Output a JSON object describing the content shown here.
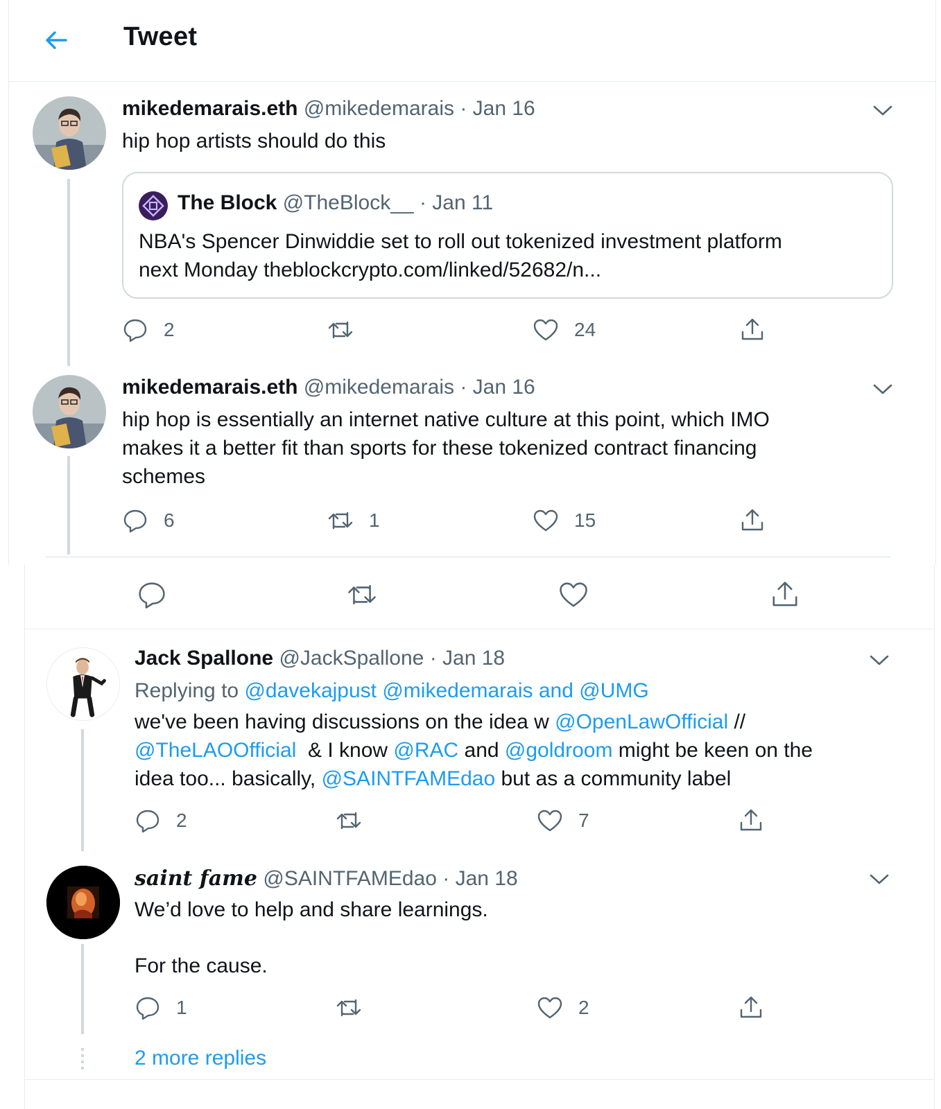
{
  "header": {
    "title": "Tweet"
  },
  "tweet1": {
    "name": "mikedemarais.eth",
    "handle": "@mikedemarais",
    "date": "· Jan 16",
    "text": "hip hop artists should do this",
    "quote": {
      "name": "The Block",
      "handle": "@TheBlock__",
      "date": "· Jan 11",
      "text_line1": "NBA's Spencer Dinwiddie set to roll out tokenized investment platform",
      "text_line2": "next Monday theblockcrypto.com/linked/52682/n..."
    },
    "replies": "2",
    "retweets": "",
    "likes": "24"
  },
  "tweet2": {
    "name": "mikedemarais.eth",
    "handle": "@mikedemarais",
    "date": "· Jan 16",
    "text_line1": "hip hop is essentially an internet native culture at this point, which IMO",
    "text_line2": "makes it a better fit than sports for these tokenized contract financing",
    "text_line3": "schemes",
    "replies": "6",
    "retweets": "1",
    "likes": "15"
  },
  "tweet3": {
    "name": "Jack Spallone",
    "handle": "@JackSpallone",
    "date": "· Jan 18",
    "replying_prefix": "Replying to",
    "replying_users": "@davekajpust @mikedemarais and @UMG",
    "l1_a": "we've been having discussions on the idea w ",
    "l1_link": "@OpenLawOfficial",
    "l1_b": " //",
    "l2_link1": "@TheLAOOfficial",
    "l2_a": "  & I know ",
    "l2_link2": "@RAC",
    "l2_b": " and ",
    "l2_link3": "@goldroom",
    "l2_c": " might be keen on the",
    "l3_a": "idea too... basically, ",
    "l3_link": "@SAINTFAMEdao",
    "l3_b": " but as a community label",
    "replies": "2",
    "retweets": "",
    "likes": "7"
  },
  "tweet4": {
    "name": "saint fame",
    "handle": "@SAINTFAMEdao",
    "date": "· Jan 18",
    "text_line1": "We’d love to help and share learnings.",
    "text_line2": "For the cause.",
    "replies": "1",
    "retweets": "",
    "likes": "2"
  },
  "more_replies": "2 more replies",
  "colors": {
    "accent": "#1d9bf0",
    "muted": "#536471",
    "border": "#e6ecf0",
    "line": "#cfd9de"
  },
  "icons": [
    "back-arrow-icon",
    "chevron-down-icon",
    "reply-icon",
    "retweet-icon",
    "like-icon",
    "share-icon"
  ]
}
